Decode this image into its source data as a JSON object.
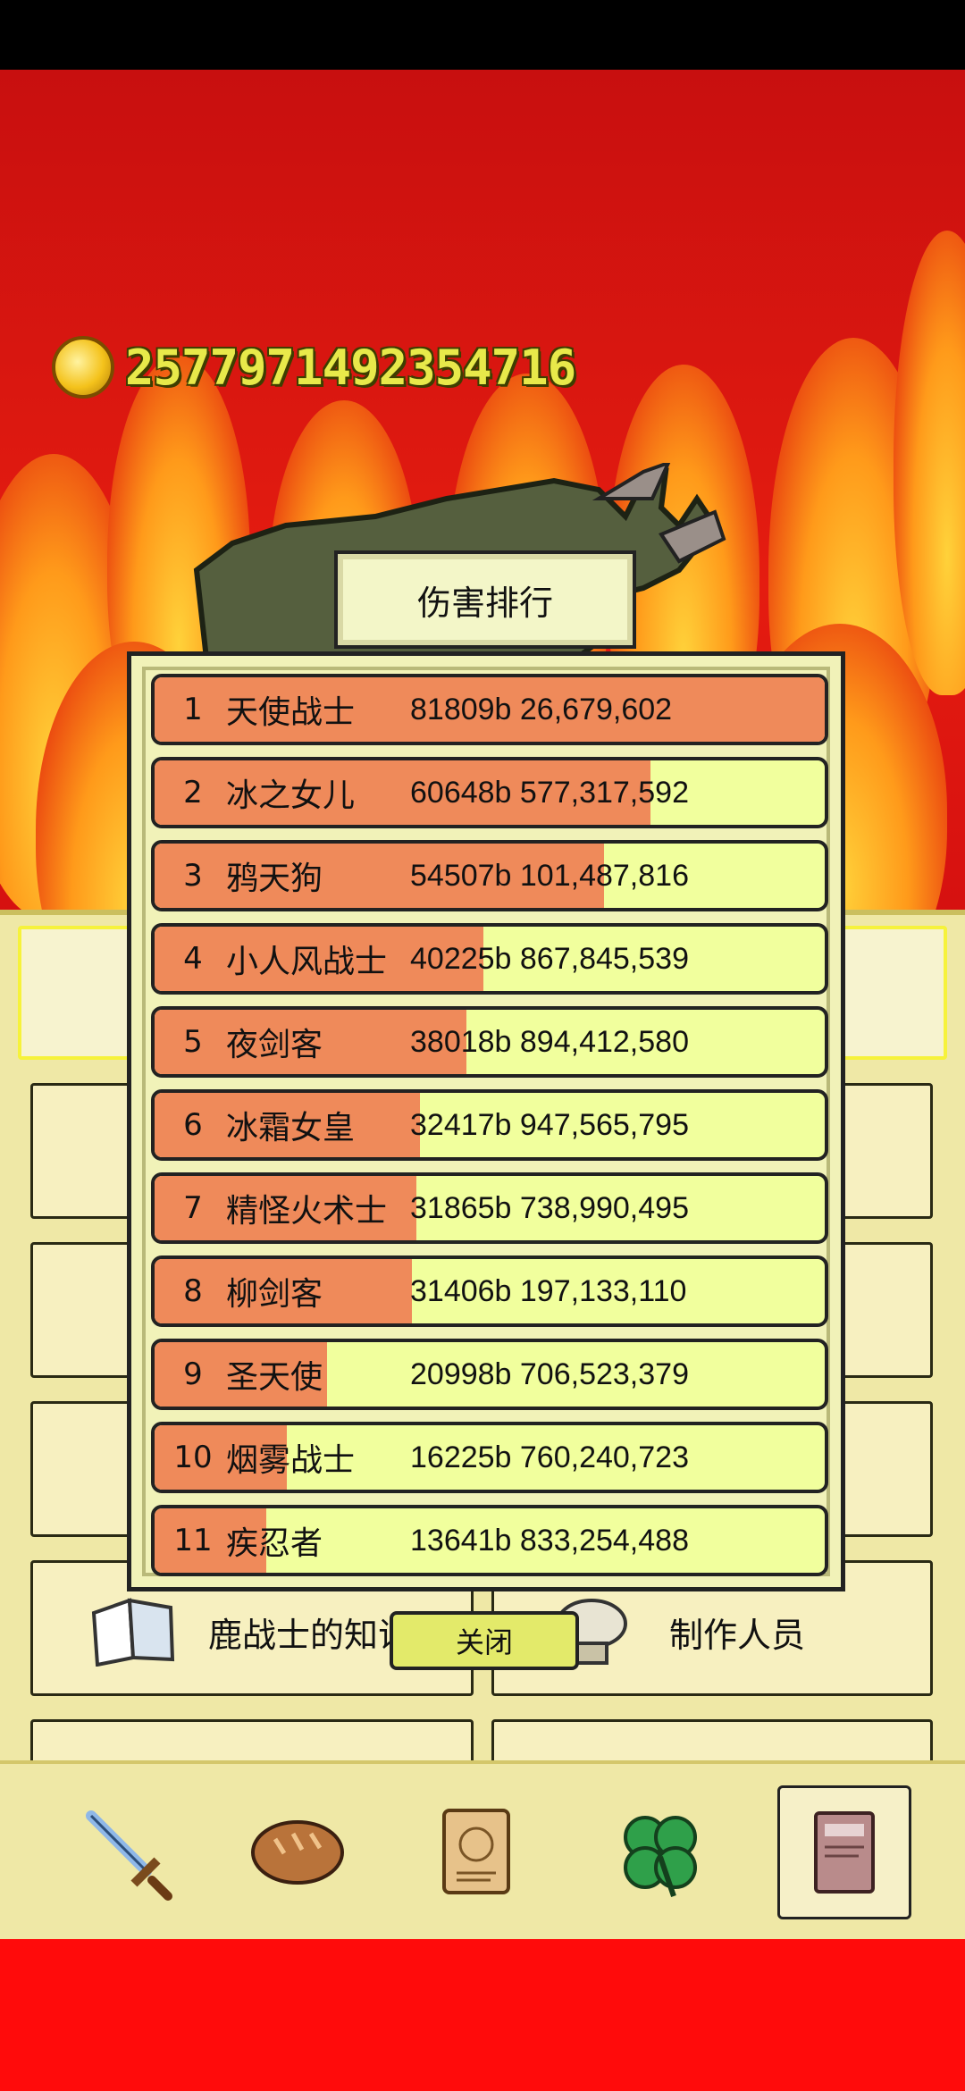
{
  "coins": "2577971492354716",
  "ranking": {
    "title": "伤害排行",
    "close_label": "关闭",
    "rows": [
      {
        "rank": "1",
        "name": "天使战士",
        "value": "81809b 26,679,602",
        "fill": 1.0
      },
      {
        "rank": "2",
        "name": "冰之女儿",
        "value": "60648b 577,317,592",
        "fill": 0.74
      },
      {
        "rank": "3",
        "name": "鸦天狗",
        "value": "54507b 101,487,816",
        "fill": 0.67
      },
      {
        "rank": "4",
        "name": "小人风战士",
        "value": "40225b 867,845,539",
        "fill": 0.49
      },
      {
        "rank": "5",
        "name": "夜剑客",
        "value": "38018b 894,412,580",
        "fill": 0.465
      },
      {
        "rank": "6",
        "name": "冰霜女皇",
        "value": "32417b 947,565,795",
        "fill": 0.396
      },
      {
        "rank": "7",
        "name": "精怪火术士",
        "value": "31865b 738,990,495",
        "fill": 0.39
      },
      {
        "rank": "8",
        "name": "柳剑客",
        "value": "31406b 197,133,110",
        "fill": 0.384
      },
      {
        "rank": "9",
        "name": "圣天使",
        "value": "20998b 706,523,379",
        "fill": 0.257
      },
      {
        "rank": "10",
        "name": "烟雾战士",
        "value": "16225b 760,240,723",
        "fill": 0.198
      },
      {
        "rank": "11",
        "name": "疾忍者",
        "value": "13641b 833,254,488",
        "fill": 0.167
      }
    ]
  },
  "menu": {
    "deer_knowledge": "鹿战士的知识",
    "credits": "制作人员"
  },
  "nav": {
    "items": [
      "sword-icon",
      "bread-icon",
      "scroll-icon",
      "clover-icon",
      "book-icon"
    ],
    "active": "book-icon"
  }
}
